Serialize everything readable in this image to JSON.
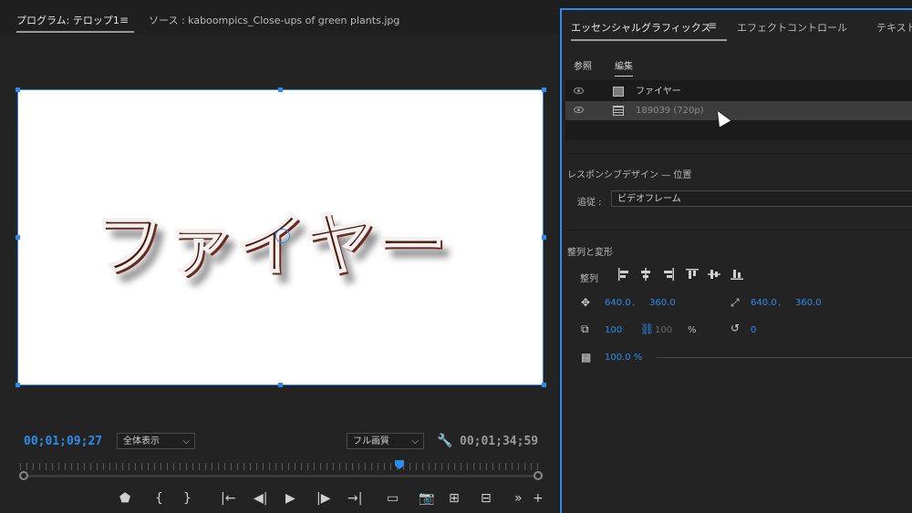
{
  "program_panel": {
    "tab_program": "プログラム: テロップ1",
    "tab_source": "ソース : kaboompics_Close-ups of green plants.jpg",
    "title_text": "ファイヤー",
    "current_timecode": "00;01;09;27",
    "zoom_select": "全体表示",
    "quality_select": "フル画質",
    "duration_timecode": "00;01;34;59"
  },
  "essential_graphics": {
    "tab_essential": "エッセンシャルグラフィックス",
    "tab_effect_controls": "エフェクトコントロール",
    "tab_text": "テキスト",
    "subtab_browse": "参照",
    "subtab_edit": "編集",
    "layers": [
      {
        "name": "ファイヤー",
        "type": "text",
        "selected": false
      },
      {
        "name": "189039 (720p)",
        "type": "clip",
        "selected": true
      }
    ],
    "responsive_label": "レスポンシブデザイン — 位置",
    "follow_label": "追従 :",
    "follow_value": "ビデオフレーム",
    "align_section": "整列と変形",
    "align_label": "整列",
    "position_x": "640.0",
    "position_y": "360.0",
    "anchor_x": "640.0",
    "anchor_y": "360.0",
    "comma": ",",
    "scale": "100",
    "scale_linked": "100",
    "percent": "%",
    "rotation": "0",
    "opacity": "100.0 %"
  },
  "colors": {
    "accent": "#2d8ceb",
    "panel_bg": "#232323"
  }
}
